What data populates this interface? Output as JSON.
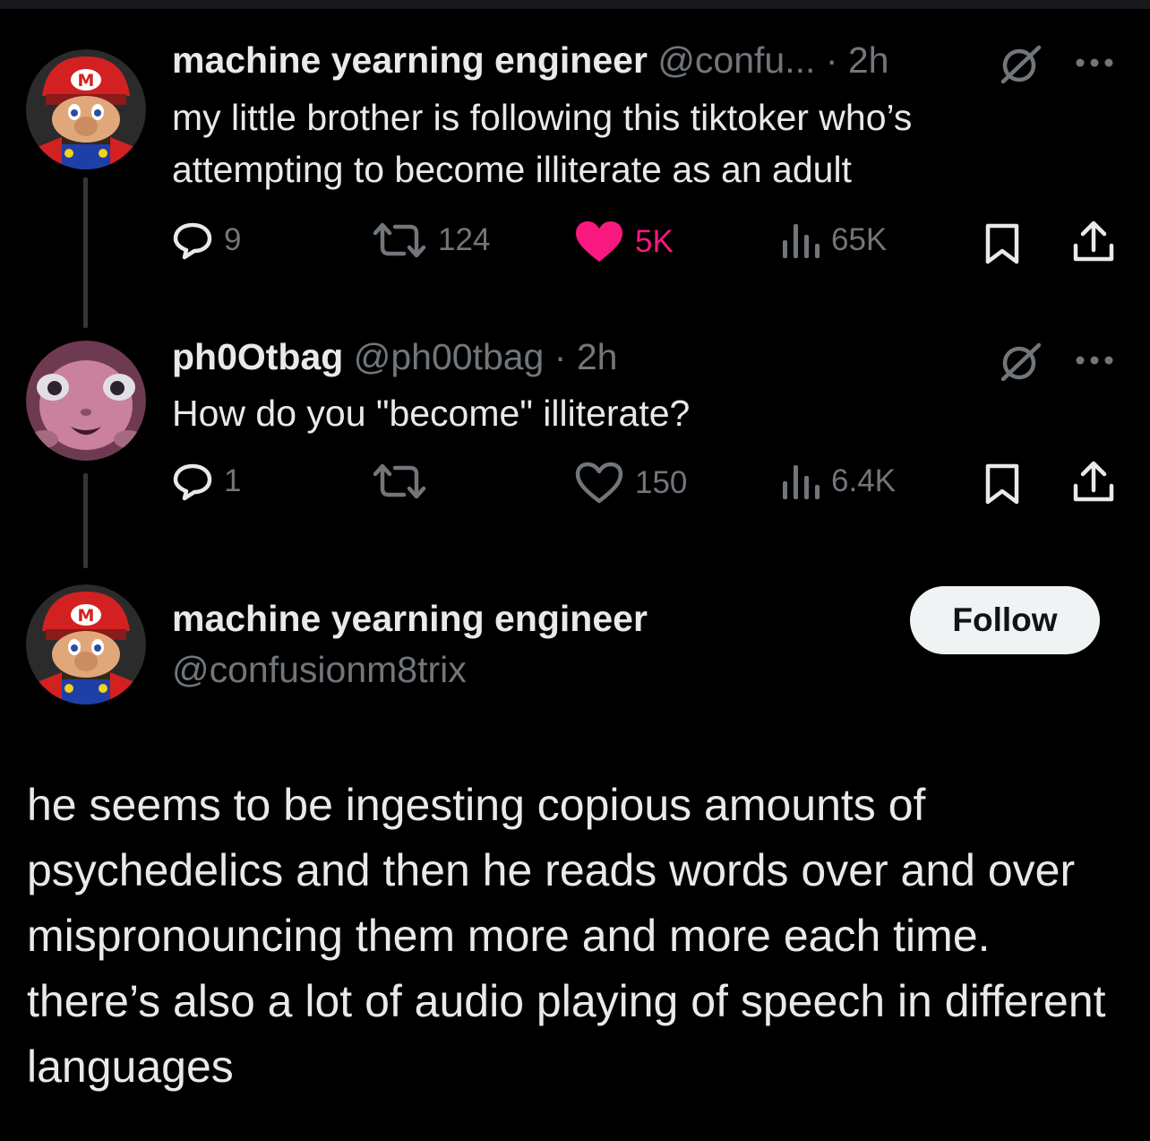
{
  "tweet1": {
    "display_name": "machine yearning engineer",
    "handle": "@confu...",
    "time": "· 2h",
    "text": "my little brother is following this tiktoker who’s attempting to become illiterate as an adult",
    "replies": "9",
    "reposts": "124",
    "likes": "5K",
    "views": "65K",
    "liked": true
  },
  "tweet2": {
    "display_name": "ph0Otbag",
    "handle": "@ph00tbag",
    "time": "· 2h",
    "text": "How do you \"become\" illiterate?",
    "replies": "1",
    "reposts": "",
    "likes": "150",
    "views": "6.4K",
    "liked": false
  },
  "main_tweet": {
    "display_name": "machine yearning engineer",
    "handle": "@confusionm8trix",
    "follow_label": "Follow",
    "text": "he seems to be ingesting copious amounts of psychedelics and then he reads words over and over mispronouncing them more and more each time. there’s also a lot of audio playing of speech in different languages"
  },
  "colors": {
    "background": "#000000",
    "text": "#e7e9ea",
    "secondary": "#71767b",
    "like": "#f91880"
  },
  "icons": [
    "reply-icon",
    "repost-icon",
    "heart-icon",
    "views-icon",
    "bookmark-icon",
    "share-icon",
    "grok-icon",
    "more-icon"
  ]
}
